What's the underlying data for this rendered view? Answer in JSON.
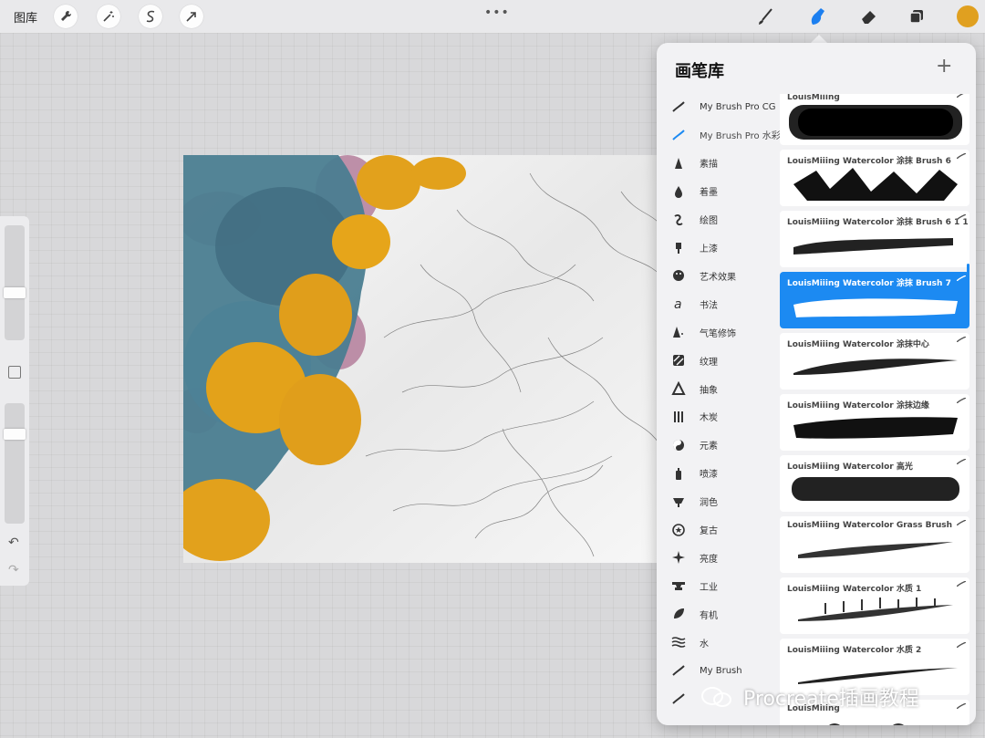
{
  "toolbar": {
    "gallery_label": "图库",
    "more_label": "•••",
    "current_color": "#e0a020"
  },
  "brush_library": {
    "title": "画笔库",
    "add_label": "+",
    "selected_color": "#1c8af2",
    "sets": [
      {
        "label": "My Brush Pro CG",
        "icon": "brush-stroke-icon"
      },
      {
        "label": "My Brush Pro 水彩",
        "icon": "brush-stroke-icon",
        "selected": true
      },
      {
        "label": "素描",
        "icon": "pencil-tip-icon"
      },
      {
        "label": "着墨",
        "icon": "ink-drop-icon"
      },
      {
        "label": "绘图",
        "icon": "squiggle-icon"
      },
      {
        "label": "上漆",
        "icon": "paint-brush-icon"
      },
      {
        "label": "艺术效果",
        "icon": "palette-icon"
      },
      {
        "label": "书法",
        "icon": "calligraphy-icon"
      },
      {
        "label": "气笔修饰",
        "icon": "airbrush-icon"
      },
      {
        "label": "纹理",
        "icon": "texture-icon"
      },
      {
        "label": "抽象",
        "icon": "triangle-icon"
      },
      {
        "label": "木炭",
        "icon": "charcoal-icon"
      },
      {
        "label": "元素",
        "icon": "yin-yang-icon"
      },
      {
        "label": "喷漆",
        "icon": "spray-can-icon"
      },
      {
        "label": "润色",
        "icon": "blend-icon"
      },
      {
        "label": "复古",
        "icon": "star-badge-icon"
      },
      {
        "label": "亮度",
        "icon": "sparkle-icon"
      },
      {
        "label": "工业",
        "icon": "anvil-icon"
      },
      {
        "label": "有机",
        "icon": "leaf-icon"
      },
      {
        "label": "水",
        "icon": "waves-icon"
      },
      {
        "label": "My Brush",
        "icon": "brush-stroke-icon"
      },
      {
        "label": "",
        "icon": "brush-stroke-icon"
      }
    ],
    "brushes": [
      {
        "name": "LouisMiiing",
        "stroke": "texture"
      },
      {
        "name": "LouisMiiing Watercolor 涂抹 Brush 6",
        "stroke": "blocks"
      },
      {
        "name": "LouisMiiing Watercolor 涂抹 Brush 6 1 1",
        "stroke": "dry"
      },
      {
        "name": "LouisMiiing Watercolor 涂抹 Brush 7",
        "stroke": "wash",
        "selected": true
      },
      {
        "name": "LouisMiiing Watercolor 涂抹中心",
        "stroke": "taper"
      },
      {
        "name": "LouisMiiing Watercolor 涂抹边缘",
        "stroke": "thick"
      },
      {
        "name": "LouisMiiing Watercolor 高光",
        "stroke": "rough"
      },
      {
        "name": "LouisMiiing Watercolor Grass Brush",
        "stroke": "grass"
      },
      {
        "name": "LouisMiiing Watercolor 水质 1",
        "stroke": "bristle"
      },
      {
        "name": "LouisMiiing Watercolor 水质 2",
        "stroke": "thin"
      },
      {
        "name": "LouisMiiing",
        "stroke": "dots"
      }
    ]
  },
  "watermark": {
    "text": "Procreate插画教程"
  }
}
